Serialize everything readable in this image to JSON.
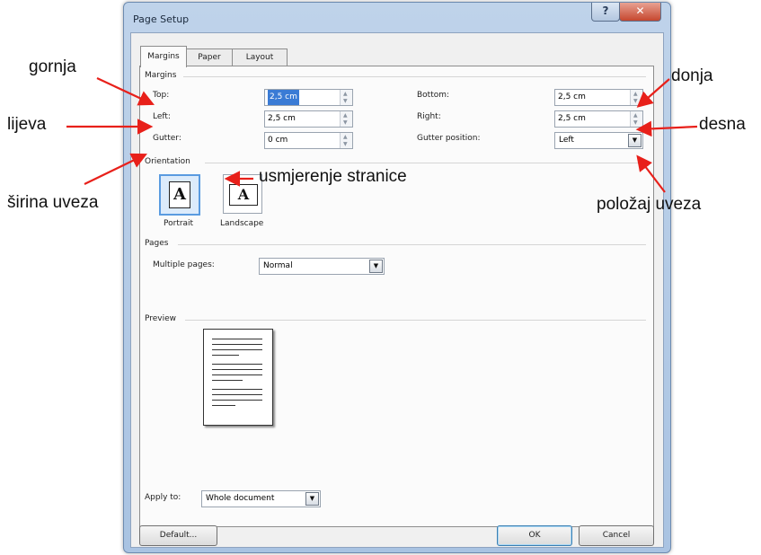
{
  "window": {
    "title": "Page Setup"
  },
  "tabs": [
    {
      "label": "Margins"
    },
    {
      "label": "Paper"
    },
    {
      "label": "Layout"
    }
  ],
  "margins": {
    "group_label": "Margins",
    "top": {
      "label": "Top:",
      "value": "2,5 cm"
    },
    "bottom": {
      "label": "Bottom:",
      "value": "2,5 cm"
    },
    "left": {
      "label": "Left:",
      "value": "2,5 cm"
    },
    "right": {
      "label": "Right:",
      "value": "2,5 cm"
    },
    "gutter": {
      "label": "Gutter:",
      "value": "0 cm"
    },
    "gutter_position": {
      "label": "Gutter position:",
      "value": "Left"
    }
  },
  "orientation": {
    "group_label": "Orientation",
    "portrait_label": "Portrait",
    "landscape_label": "Landscape",
    "glyph": "A",
    "selected": "Portrait"
  },
  "pages": {
    "group_label": "Pages",
    "multiple_label": "Multiple pages:",
    "multiple_value": "Normal"
  },
  "preview": {
    "group_label": "Preview"
  },
  "apply": {
    "label": "Apply to:",
    "value": "Whole document"
  },
  "buttons": {
    "default": "Default...",
    "ok": "OK",
    "cancel": "Cancel"
  },
  "annotations": {
    "gornja": "gornja",
    "lijeva": "lijeva",
    "sirina_uveza": "širina uveza",
    "usmjerenje": "usmjerenje stranice",
    "donja": "donja",
    "desna": "desna",
    "polozaj_uveza": "položaj uveza"
  },
  "colors": {
    "annotation_arrow": "#e8201a",
    "accent": "#3a7bd5"
  },
  "icons": {
    "help": "question-mark",
    "close": "x-mark",
    "spin_up": "triangle-up",
    "spin_down": "triangle-down",
    "combo": "triangle-down"
  }
}
